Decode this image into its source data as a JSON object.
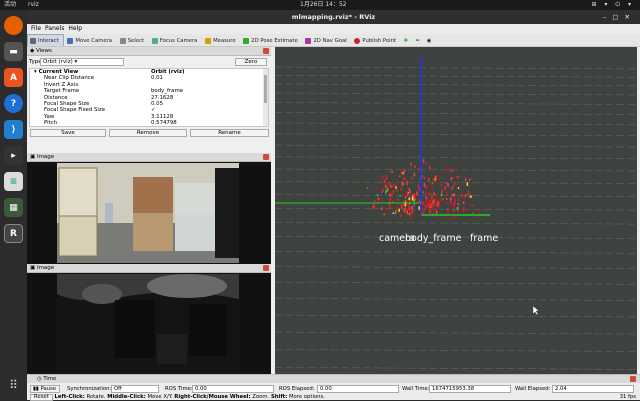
{
  "topbar": {
    "activities": "活动",
    "app": "rviz",
    "clock": "1月26日  14：52",
    "tray": "⊞ ▾ ⏻ ▾"
  },
  "window": {
    "title": "mlmapping.rviz* - RViz"
  },
  "menu": {
    "file": "File",
    "panels": "Panels",
    "help": "Help"
  },
  "toolbar": {
    "interact": "Interact",
    "move_camera": "Move Camera",
    "select": "Select",
    "focus_camera": "Focus Camera",
    "measure": "Measure",
    "pose_estimate": "2D Pose Estimate",
    "nav_goal": "2D Nav Goal",
    "publish_point": "Publish Point"
  },
  "views": {
    "title": "Views",
    "type_label": "Type:",
    "type_value": "Orbit (rviz)",
    "zero": "Zero",
    "header": {
      "k": "Current View",
      "v": "Orbit (rviz)"
    },
    "rows": [
      {
        "k": "Near Clip Distance",
        "v": "0.01"
      },
      {
        "k": "Invert Z Axis",
        "v": ""
      },
      {
        "k": "Target Frame",
        "v": "body_frame"
      },
      {
        "k": "Distance",
        "v": "27.1628"
      },
      {
        "k": "Focal Shape Size",
        "v": "0.05"
      },
      {
        "k": "Focal Shape Fixed Size",
        "v": "✓"
      },
      {
        "k": "Yaw",
        "v": "3.11128"
      },
      {
        "k": "Pitch",
        "v": "0.574798"
      }
    ],
    "save": "Save",
    "remove": "Remove",
    "rename": "Rename"
  },
  "image1": {
    "title": "Image"
  },
  "image2": {
    "title": "Image"
  },
  "viewport": {
    "label1": "camera",
    "label2": "body_frame",
    "label3": "frame",
    "axis_colors": {
      "x": "#dd2222",
      "y": "#22cc22",
      "z": "#2233ee"
    }
  },
  "time": {
    "title": "Time",
    "pause": "Pause",
    "sync_label": "Synchronization:",
    "sync_value": "Off",
    "ros_time_label": "ROS Time:",
    "ros_time": "0.00",
    "ros_elapsed_label": "ROS Elapsed:",
    "ros_elapsed": "0.00",
    "wall_time_label": "Wall Time:",
    "wall_time": "1674715953.38",
    "wall_elapsed_label": "Wall Elapsed:",
    "wall_elapsed": "2.04"
  },
  "status": {
    "reset": "Reset",
    "hint_left": "Left-Click:",
    "hint_left_v": " Rotate. ",
    "hint_mid": "Middle-Click:",
    "hint_mid_v": " Move X/Y. ",
    "hint_right": "Right-Click/Mouse Wheel:",
    "hint_right_v": " Zoom. ",
    "hint_shift": "Shift:",
    "hint_shift_v": " More options.",
    "fps": "31 fps"
  }
}
